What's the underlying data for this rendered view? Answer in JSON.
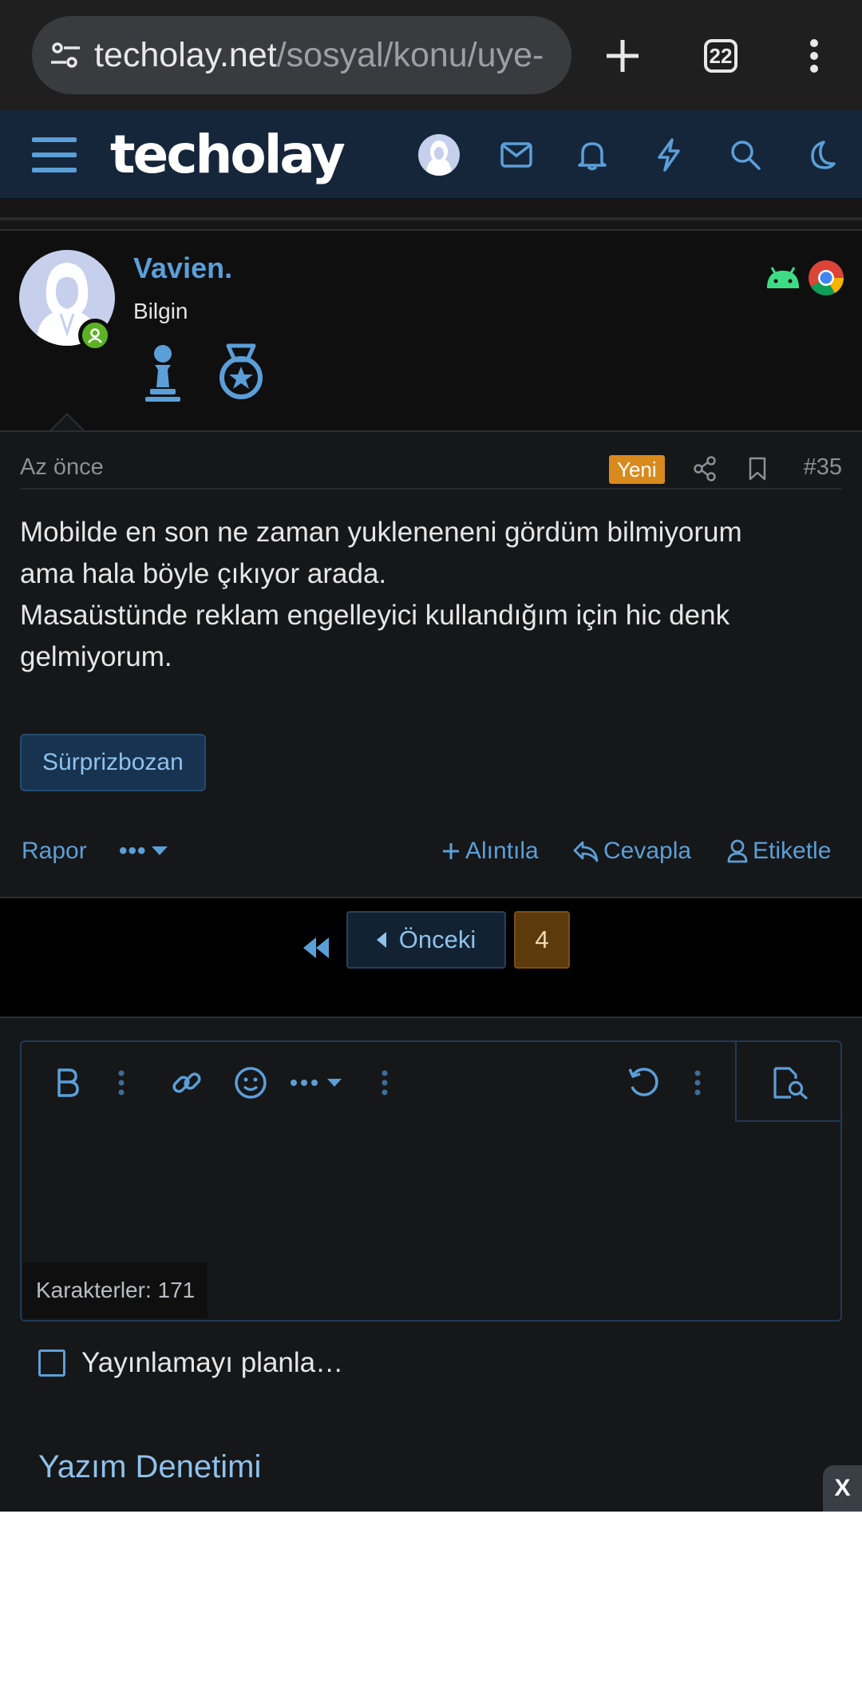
{
  "browser": {
    "url_host": "techolay.net",
    "url_path": "/sosyal/konu/uye-",
    "tab_count": "22",
    "icons": [
      "tune-icon",
      "plus-icon",
      "tabs-icon",
      "more-vert-icon"
    ]
  },
  "header": {
    "logo": "techolay",
    "icons": [
      "menu-icon",
      "avatar",
      "mail-icon",
      "bell-icon",
      "bolt-icon",
      "search-icon",
      "moon-icon"
    ],
    "accent_color": "#5b9fd8",
    "background_color": "#16263a"
  },
  "post": {
    "author": "Vavien.",
    "user_title": "Bilgin",
    "trophies": [
      "pawn-icon",
      "medal-icon"
    ],
    "platforms": [
      "android-icon",
      "chrome-icon"
    ],
    "date": "Az önce",
    "new_badge": "Yeni",
    "number": "#35",
    "text_lines": [
      "Mobilde en son ne zaman yuklenen",
      "eni gördüm bilmiyorum",
      "ama hala böyle çıkıyor arada.",
      "Masaüstünde reklam engelleyici kullandığım için hic denk",
      "gelmiyorum."
    ],
    "line1": "Mobilde en son ne zaman yuklenenen",
    "line1b": "i gördüm bilmiyorum",
    "line2": "ama hala böyle çıkıyor arada.",
    "line3": "Masaüstünde reklam engelleyici kullandığım için hic denk",
    "line4": "gelmiyorum.",
    "spoiler_label": "Sürprizbozan",
    "actions": {
      "report": "Rapor",
      "more": "•••",
      "quote": "Alıntıla",
      "reply": "Cevapla",
      "tag": "Etiketle"
    }
  },
  "pagination": {
    "prev_label": "Önceki",
    "current_page": "4"
  },
  "editor": {
    "char_count": "Karakterler: 171",
    "toolbar": [
      "bold-icon",
      "more-vert-icon",
      "link-icon",
      "emoji-icon",
      "more-dropdown-icon",
      "more-vert-icon",
      "undo-icon",
      "more-vert-icon",
      "preview-icon"
    ],
    "schedule_label": "Yayınlamayı planla…",
    "section_title": "Yazım Denetimi",
    "close_label": "X"
  }
}
